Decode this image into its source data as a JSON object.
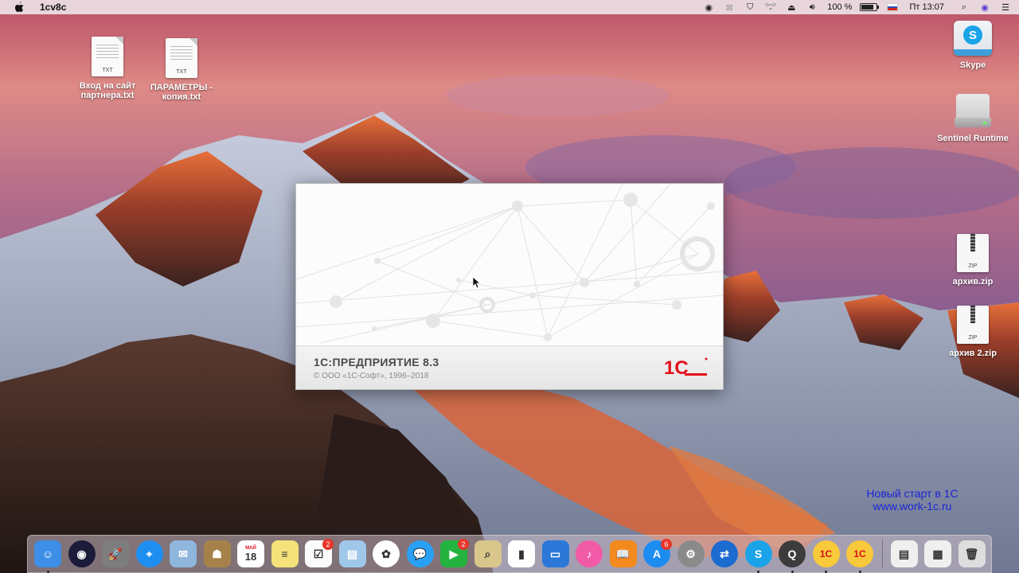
{
  "menubar": {
    "app_name": "1cv8c",
    "volume_percent": "100 %",
    "clock": "Пт 13:07",
    "battery_level": 0.8
  },
  "desktop": {
    "left_icons": [
      {
        "label": "Вход на сайт партнера.txt",
        "ext": "TXT"
      },
      {
        "label": "ПАРАМЕТРЫ - копия.txt",
        "ext": "TXT"
      }
    ],
    "right_icons": [
      {
        "label": "Skype"
      },
      {
        "label": "Sentinel Runtime"
      },
      {
        "label": "архив.zip",
        "ext": "ZIP"
      },
      {
        "label": "архив 2.zip",
        "ext": "ZIP"
      }
    ]
  },
  "splash": {
    "title": "1С:ПРЕДПРИЯТИЕ 8.3",
    "copyright": "© ООО «1С-Софт», 1996–2018",
    "logo_text": "1С",
    "logo_color": "#e3111b"
  },
  "watermark": {
    "line1": "Новый старт в 1С",
    "line2": "www.work-1c.ru"
  },
  "dock": {
    "items": [
      {
        "icon": "finder-icon",
        "color": "#3d8ee6",
        "glyph": "☺",
        "running": true
      },
      {
        "icon": "siri-icon",
        "color": "#1b1b3a",
        "glyph": "◉"
      },
      {
        "icon": "launchpad-icon",
        "color": "#7d7d7d",
        "glyph": "🚀"
      },
      {
        "icon": "safari-icon",
        "color": "#1f8ef1",
        "glyph": "⌖"
      },
      {
        "icon": "mail-bird-icon",
        "color": "#8fb6dd",
        "glyph": "✉"
      },
      {
        "icon": "contacts-icon",
        "color": "#a6824a",
        "glyph": "☗"
      },
      {
        "icon": "calendar-icon",
        "color": "#ffffff",
        "glyph": "18",
        "month": "МАЙ"
      },
      {
        "icon": "notes-icon",
        "color": "#f5e27a",
        "glyph": "≡"
      },
      {
        "icon": "reminders-icon",
        "color": "#fbfbfb",
        "glyph": "☑",
        "badge": "2"
      },
      {
        "icon": "preview-icon",
        "color": "#9fc7ea",
        "glyph": "▤"
      },
      {
        "icon": "photos-icon",
        "color": "#ffffff",
        "glyph": "✿"
      },
      {
        "icon": "messages-icon",
        "color": "#2aa0f5",
        "glyph": "💬"
      },
      {
        "icon": "facetime-icon",
        "color": "#25b340",
        "glyph": "▶",
        "badge": "2"
      },
      {
        "icon": "maps-icon",
        "color": "#d9c68a",
        "glyph": "⌕"
      },
      {
        "icon": "numbers-icon",
        "color": "#ffffff",
        "glyph": "▮"
      },
      {
        "icon": "keynote-icon",
        "color": "#2b78d8",
        "glyph": "▭"
      },
      {
        "icon": "itunes-icon",
        "color": "#f05aa6",
        "glyph": "♪"
      },
      {
        "icon": "ibooks-icon",
        "color": "#f28a1d",
        "glyph": "📖"
      },
      {
        "icon": "app-store-icon",
        "color": "#1d8cf0",
        "glyph": "A",
        "badge": "6"
      },
      {
        "icon": "system-preferences-icon",
        "color": "#8a8a8a",
        "glyph": "⚙"
      },
      {
        "icon": "teamviewer-icon",
        "color": "#1c6bd1",
        "glyph": "⇄"
      },
      {
        "icon": "skype-icon",
        "color": "#1aa3e8",
        "glyph": "S",
        "running": true
      },
      {
        "icon": "quicktime-icon",
        "color": "#3c3c3c",
        "glyph": "Q",
        "running": true
      },
      {
        "icon": "1c-enterprise-icon",
        "color": "#f7c93b",
        "glyph": "1С",
        "running": true
      },
      {
        "icon": "1c-enterprise-2-icon",
        "color": "#f7c93b",
        "glyph": "1С",
        "running": true
      }
    ],
    "right_items": [
      {
        "icon": "downloads-stack-icon",
        "color": "#efefef",
        "glyph": "▤"
      },
      {
        "icon": "documents-stack-icon",
        "color": "#efefef",
        "glyph": "▦"
      },
      {
        "icon": "trash-icon",
        "color": "#dddddd",
        "glyph": "🗑"
      }
    ]
  }
}
